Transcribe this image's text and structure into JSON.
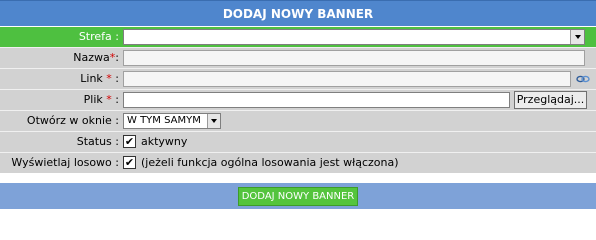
{
  "header": {
    "title": "DODAJ NOWY BANNER"
  },
  "form": {
    "strefa": {
      "label": "Strefa :",
      "value": ""
    },
    "nazwa": {
      "label": "Nazwa",
      "required_mark": "*",
      "suffix": ":",
      "value": ""
    },
    "link": {
      "label": "Link ",
      "required_mark": "*",
      "suffix": " :",
      "value": "",
      "icon": "link-icon"
    },
    "plik": {
      "label": "Plik ",
      "required_mark": "*",
      "suffix": " :",
      "value": "",
      "browse_label": "Przeglądaj..."
    },
    "otworz": {
      "label": "Otwórz w oknie :",
      "selected": "W TYM SAMYM"
    },
    "status": {
      "label": "Status :",
      "checked": true,
      "checkbox_text": "aktywny"
    },
    "losowo": {
      "label": "Wyświetlaj losowo :",
      "checked": true,
      "checkbox_text": "(jeżeli funkcja ogólna losowania jest włączona)"
    }
  },
  "submit": {
    "label": "DODAJ NOWY BANNER"
  },
  "colors": {
    "header": "#4f86cd",
    "row": "#d2d2d2",
    "active_row": "#4ec040",
    "submit": "#54c43d",
    "required": "#d40000"
  }
}
